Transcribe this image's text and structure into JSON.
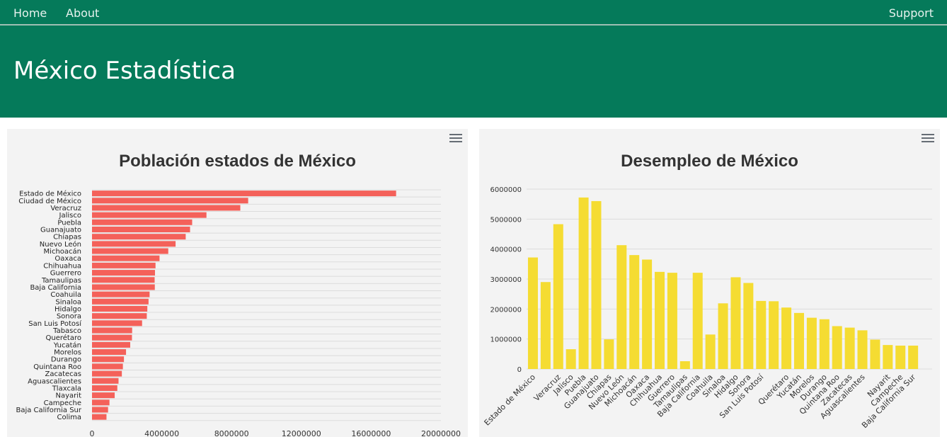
{
  "nav": {
    "home": "Home",
    "about": "About",
    "support": "Support"
  },
  "hero": {
    "title": "México Estadística"
  },
  "colors": {
    "brand": "#057a5a",
    "bar_poblacion": "#f4615a",
    "bar_desempleo": "#f5dc32"
  },
  "icons": {
    "menu": "hamburger-menu-icon"
  },
  "chart_data": [
    {
      "type": "bar",
      "orientation": "horizontal",
      "title": "Población estados de México",
      "xlim": [
        0,
        20000000
      ],
      "ticks": [
        "0",
        "4000000",
        "8000000",
        "12000000",
        "16000000",
        "20000000"
      ],
      "grid": true,
      "categories": [
        "Estado de México",
        "Ciudad de México",
        "Veracruz",
        "Jalisco",
        "Puebla",
        "Guanajuato",
        "Chiapas",
        "Nuevo León",
        "Michoacán",
        "Oaxaca",
        "Chihuahua",
        "Guerrero",
        "Tamaulipas",
        "Baja California",
        "Coahuila",
        "Sinaloa",
        "Hidalgo",
        "Sonora",
        "San Luis Potosí",
        "Tabasco",
        "Querétaro",
        "Yucatán",
        "Morelos",
        "Durango",
        "Quintana Roo",
        "Zacatecas",
        "Aguascalientes",
        "Tlaxcala",
        "Nayarit",
        "Campeche",
        "Baja California Sur",
        "Colima"
      ],
      "values": [
        17430000,
        8950000,
        8500000,
        6560000,
        5740000,
        5620000,
        5370000,
        4790000,
        4370000,
        3870000,
        3640000,
        3610000,
        3590000,
        3600000,
        3300000,
        3240000,
        3170000,
        3140000,
        2870000,
        2300000,
        2290000,
        2190000,
        1950000,
        1830000,
        1770000,
        1710000,
        1520000,
        1450000,
        1300000,
        1000000,
        920000,
        830000
      ]
    },
    {
      "type": "bar",
      "title": "Desempleo de México",
      "ylim": [
        0,
        6000000
      ],
      "ticks": [
        "0",
        "1000000",
        "2000000",
        "3000000",
        "4000000",
        "5000000",
        "6000000"
      ],
      "grid": true,
      "categories": [
        "Estado de México",
        "Ciudad de México",
        "Veracruz",
        "Jalisco",
        "Puebla",
        "Guanajuato",
        "Chiapas",
        "Nuevo León",
        "Michoacán",
        "Oaxaca",
        "Chihuahua",
        "Guerrero",
        "Tamaulipas",
        "Baja California",
        "Coahuila",
        "Sinaloa",
        "Hidalgo",
        "Sonora",
        "San Luis Potosí",
        "Tabasco",
        "Querétaro",
        "Yucatán",
        "Morelos",
        "Durango",
        "Quintana Roo",
        "Zacatecas",
        "Aguascalientes",
        "Tlaxcala",
        "Nayarit",
        "Campeche",
        "Baja California Sur",
        "Colima"
      ],
      "x_label_visible": [
        true,
        false,
        true,
        true,
        true,
        true,
        true,
        true,
        true,
        true,
        true,
        true,
        true,
        true,
        true,
        true,
        true,
        true,
        true,
        false,
        true,
        true,
        true,
        true,
        true,
        true,
        true,
        false,
        true,
        true,
        true,
        false
      ],
      "values": [
        3720000,
        2900000,
        4830000,
        660000,
        5720000,
        5600000,
        990000,
        4130000,
        3800000,
        3650000,
        3240000,
        3210000,
        260000,
        3210000,
        1150000,
        2190000,
        3060000,
        2870000,
        2270000,
        2260000,
        2050000,
        1870000,
        1710000,
        1660000,
        1430000,
        1380000,
        1290000,
        980000,
        800000,
        780000,
        780000,
        0
      ]
    }
  ]
}
